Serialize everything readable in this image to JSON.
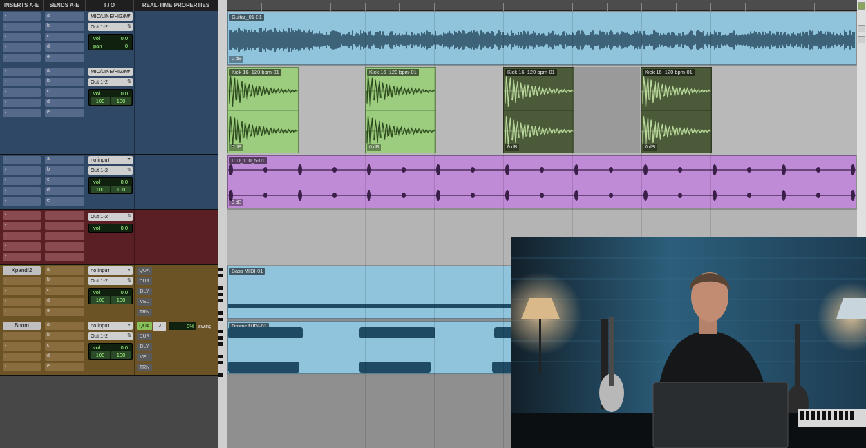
{
  "header": {
    "inserts": "INSERTS A-E",
    "sends": "SENDS A-E",
    "io": "I / O",
    "rtp": "REAL-TIME PROPERTIES"
  },
  "send_letters": [
    "a",
    "b",
    "c",
    "d",
    "e"
  ],
  "tracks": [
    {
      "color": "#2f4866",
      "input": "MIC/LINE/HIZ/M",
      "output": "Out 1-2",
      "vol": "0.0",
      "pan_label": "pan",
      "pan": "0"
    },
    {
      "color": "#2f4866",
      "input": "MIC/LINE/HIZ/M",
      "output": "Out 1-2",
      "vol": "0.0",
      "pan_l": "100",
      "pan_r": "100"
    },
    {
      "color": "#2f4866",
      "input": "no input",
      "output": "Out 1-2",
      "vol": "0.0",
      "pan_l": "100",
      "pan_r": "100"
    },
    {
      "color": "#5a1f24",
      "output": "Out 1-2",
      "vol": "0.0"
    },
    {
      "color": "#6b5326",
      "insert_a": "Xpand!2",
      "input": "no input",
      "output": "Out 1-2",
      "vol": "0.0",
      "pan_l": "100",
      "pan_r": "100",
      "rtp": [
        "QUA",
        "DUR",
        "DLY",
        "VEL",
        "TRN"
      ]
    },
    {
      "color": "#6b5326",
      "insert_a": "Boom",
      "input": "no input",
      "output": "Out 1-2",
      "vol": "0.0",
      "pan_l": "100",
      "pan_r": "100",
      "rtp": [
        "QUA",
        "DUR",
        "DLY",
        "VEL",
        "TRN"
      ],
      "swing_value": "0%",
      "swing_label": "swing"
    }
  ],
  "clips": {
    "guitar": {
      "name": "Guitar_01-01",
      "gain": "0 dB",
      "color": "#8fc4dc"
    },
    "kick": {
      "name": "Kick 16_120 bpm-01",
      "gain": "0 dB"
    },
    "loop": {
      "name": "L10_110_5-01",
      "gain": "0 dB",
      "color": "#c08bd6"
    },
    "bass": {
      "name": "Bass MIDI-01",
      "color": "#8fc4dc"
    },
    "drums": {
      "name": "Drums MIDI-01",
      "color": "#8fc4dc"
    }
  },
  "colors": {
    "kick_active": "#9ccd7e",
    "kick_muted": "#4b5a38",
    "wave_dark": "#1b3a4f",
    "midi_note": "#1f4a63"
  }
}
